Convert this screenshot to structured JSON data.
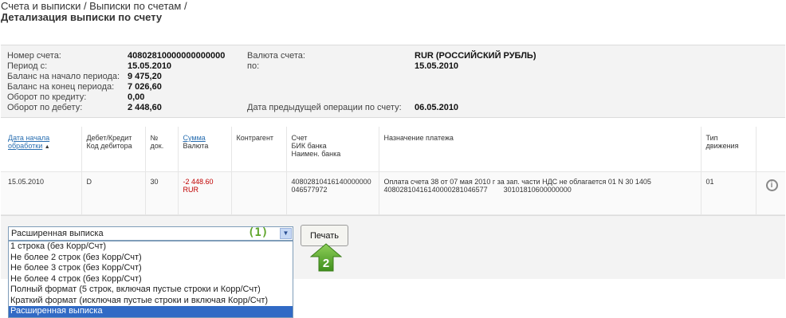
{
  "breadcrumb": "Счета и выписки / Выписки по счетам /",
  "page_title": "Детализация выписки по счету",
  "account_info": {
    "account_number_label": "Номер счета:",
    "account_number": "40802810000000000000",
    "currency_label": "Валюта счета:",
    "currency": "RUR (РОССИЙСКИЙ РУБЛЬ)",
    "period_from_label": "Период с:",
    "period_from": "15.05.2010",
    "period_to_label": "по:",
    "period_to": "15.05.2010",
    "balance_start_label": "Баланс на начало периода:",
    "balance_start": "9 475,20",
    "balance_end_label": "Баланс на конец периода:",
    "balance_end": "7 026,60",
    "credit_turnover_label": "Оборот по кредиту:",
    "credit_turnover": "0,00",
    "debit_turnover_label": "Оборот по дебету:",
    "debit_turnover": "2 448,60",
    "prev_operation_label": "Дата предыдущей операции по счету:",
    "prev_operation": "06.05.2010"
  },
  "table": {
    "headers": {
      "date_line1": "Дата начала",
      "date_line2": "обработки",
      "debit_credit_line1": "Дебет/Кредит",
      "debit_credit_line2": "Код дебитора",
      "doc_no_line1": "№",
      "doc_no_line2": "док.",
      "amount_line1": "Сумма",
      "amount_line2": "Валюта",
      "counterparty": "Контрагент",
      "account_line1": "Счет",
      "account_line2": "БИК банка",
      "account_line3": "Наимен. банка",
      "purpose": "Назначение платежа",
      "type_line1": "Тип",
      "type_line2": "движения"
    },
    "rows": [
      {
        "date": "15.05.2010",
        "debit_credit": "D",
        "doc_no": "30",
        "amount": "-2 448.60",
        "currency": "RUR",
        "counterparty": "",
        "account": "40802810416140000000",
        "bik": "046577972",
        "purpose_line1": "Оплата счета 38 от 07 мая 2010 г за зап. части НДС не облагается 01 N 30 1405",
        "purpose_line2": "40802810416140000281046577        30101810600000000",
        "type": "01"
      }
    ]
  },
  "format_select": {
    "selected": "Расширенная выписка",
    "options": [
      "1 строка (без Корр/Счт)",
      "Не более 2 строк (без Корр/Счт)",
      "Не более 3 строк (без Корр/Счт)",
      "Не более 4 строк (без Корр/Счт)",
      "Полный формат (5 строк, включая пустые строки и Корр/Счт)",
      "Краткий формат (исключая пустые строки и включая Корр/Счт)",
      "Расширенная выписка"
    ]
  },
  "step1_label": "(1)",
  "step2_label": "2",
  "print_button": "Печать",
  "colors": {
    "accent_green": "#5fa52b",
    "link": "#2a6fb1",
    "negative": "#c00000",
    "selection": "#316ac5"
  },
  "icons": {
    "sort": "sort-asc-icon",
    "details": "info-icon",
    "step_arrow": "up-arrow-icon"
  }
}
